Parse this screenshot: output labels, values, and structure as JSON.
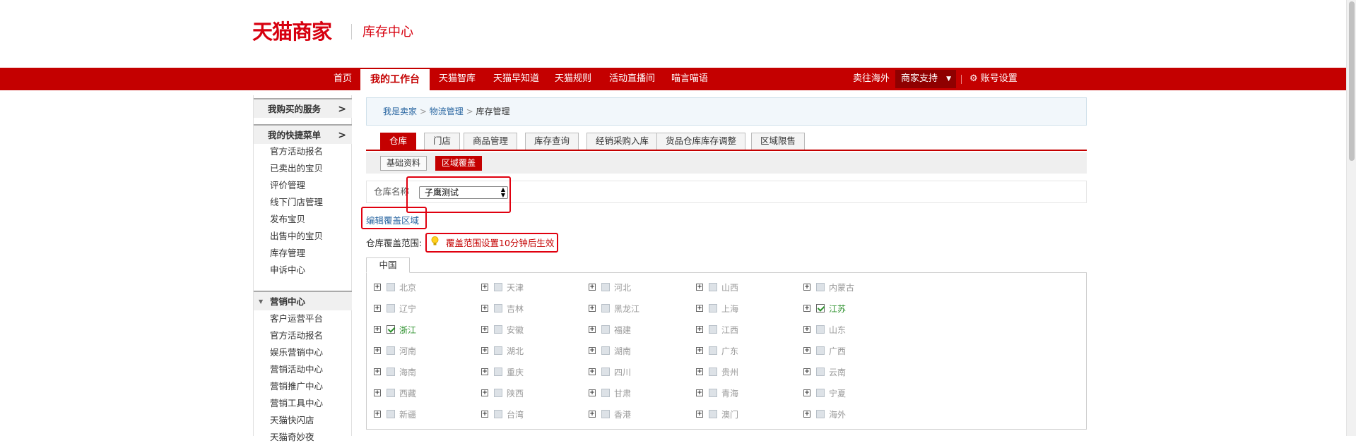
{
  "header": {
    "logo": "天猫商家",
    "subtitle": "库存中心"
  },
  "nav": {
    "items": [
      "首页",
      "我的工作台",
      "天猫智库",
      "天猫早知道",
      "天猫规则",
      "活动直播间",
      "喵言喵语"
    ],
    "active": "我的工作台",
    "right": {
      "overseas": "卖往海外",
      "support": "商家支持",
      "account": "账号设置"
    }
  },
  "sidebar": {
    "purchased": "我购买的服务",
    "quick_menu": "我的快捷菜单",
    "arrow": ">",
    "quick_items": [
      "官方活动报名",
      "已卖出的宝贝",
      "评价管理",
      "线下门店管理",
      "发布宝贝",
      "出售中的宝贝",
      "库存管理",
      "申诉中心"
    ],
    "marketing_title": "营销中心",
    "marketing_items": [
      "客户运营平台",
      "官方活动报名",
      "娱乐营销中心",
      "营销活动中心",
      "营销推广中心",
      "营销工具中心",
      "天猫快闪店",
      "天猫奇妙夜"
    ]
  },
  "breadcrumb": {
    "seller": "我是卖家",
    "logistics": "物流管理",
    "current": "库存管理",
    "sep": ">"
  },
  "tabs": [
    "仓库",
    "门店",
    "商品管理",
    "库存查询",
    "经销采购入库",
    "货品仓库库存调整",
    "区域限售"
  ],
  "subtabs": [
    "基础资料",
    "区域覆盖"
  ],
  "warehouse": {
    "label": "仓库名称",
    "value": "子鹰测试"
  },
  "edit_link": "编辑覆盖区域",
  "coverage": {
    "label": "仓库覆盖范围:",
    "tip": "覆盖范围设置10分钟后生效"
  },
  "region_tab": "中国",
  "provinces": [
    {
      "name": "北京",
      "checked": false
    },
    {
      "name": "天津",
      "checked": false
    },
    {
      "name": "河北",
      "checked": false
    },
    {
      "name": "山西",
      "checked": false
    },
    {
      "name": "内蒙古",
      "checked": false
    },
    {
      "name": "辽宁",
      "checked": false
    },
    {
      "name": "吉林",
      "checked": false
    },
    {
      "name": "黑龙江",
      "checked": false
    },
    {
      "name": "上海",
      "checked": false
    },
    {
      "name": "江苏",
      "checked": true
    },
    {
      "name": "浙江",
      "checked": true
    },
    {
      "name": "安徽",
      "checked": false
    },
    {
      "name": "福建",
      "checked": false
    },
    {
      "name": "江西",
      "checked": false
    },
    {
      "name": "山东",
      "checked": false
    },
    {
      "name": "河南",
      "checked": false
    },
    {
      "name": "湖北",
      "checked": false
    },
    {
      "name": "湖南",
      "checked": false
    },
    {
      "name": "广东",
      "checked": false
    },
    {
      "name": "广西",
      "checked": false
    },
    {
      "name": "海南",
      "checked": false
    },
    {
      "name": "重庆",
      "checked": false
    },
    {
      "name": "四川",
      "checked": false
    },
    {
      "name": "贵州",
      "checked": false
    },
    {
      "name": "云南",
      "checked": false
    },
    {
      "name": "西藏",
      "checked": false
    },
    {
      "name": "陕西",
      "checked": false
    },
    {
      "name": "甘肃",
      "checked": false
    },
    {
      "name": "青海",
      "checked": false
    },
    {
      "name": "宁夏",
      "checked": false
    },
    {
      "name": "新疆",
      "checked": false
    },
    {
      "name": "台湾",
      "checked": false
    },
    {
      "name": "香港",
      "checked": false
    },
    {
      "name": "澳门",
      "checked": false
    },
    {
      "name": "海外",
      "checked": false
    }
  ],
  "colors": {
    "brand": "#c40000",
    "highlight": "#e0000f",
    "link": "#2966a1",
    "checked": "#2a8f2a"
  }
}
